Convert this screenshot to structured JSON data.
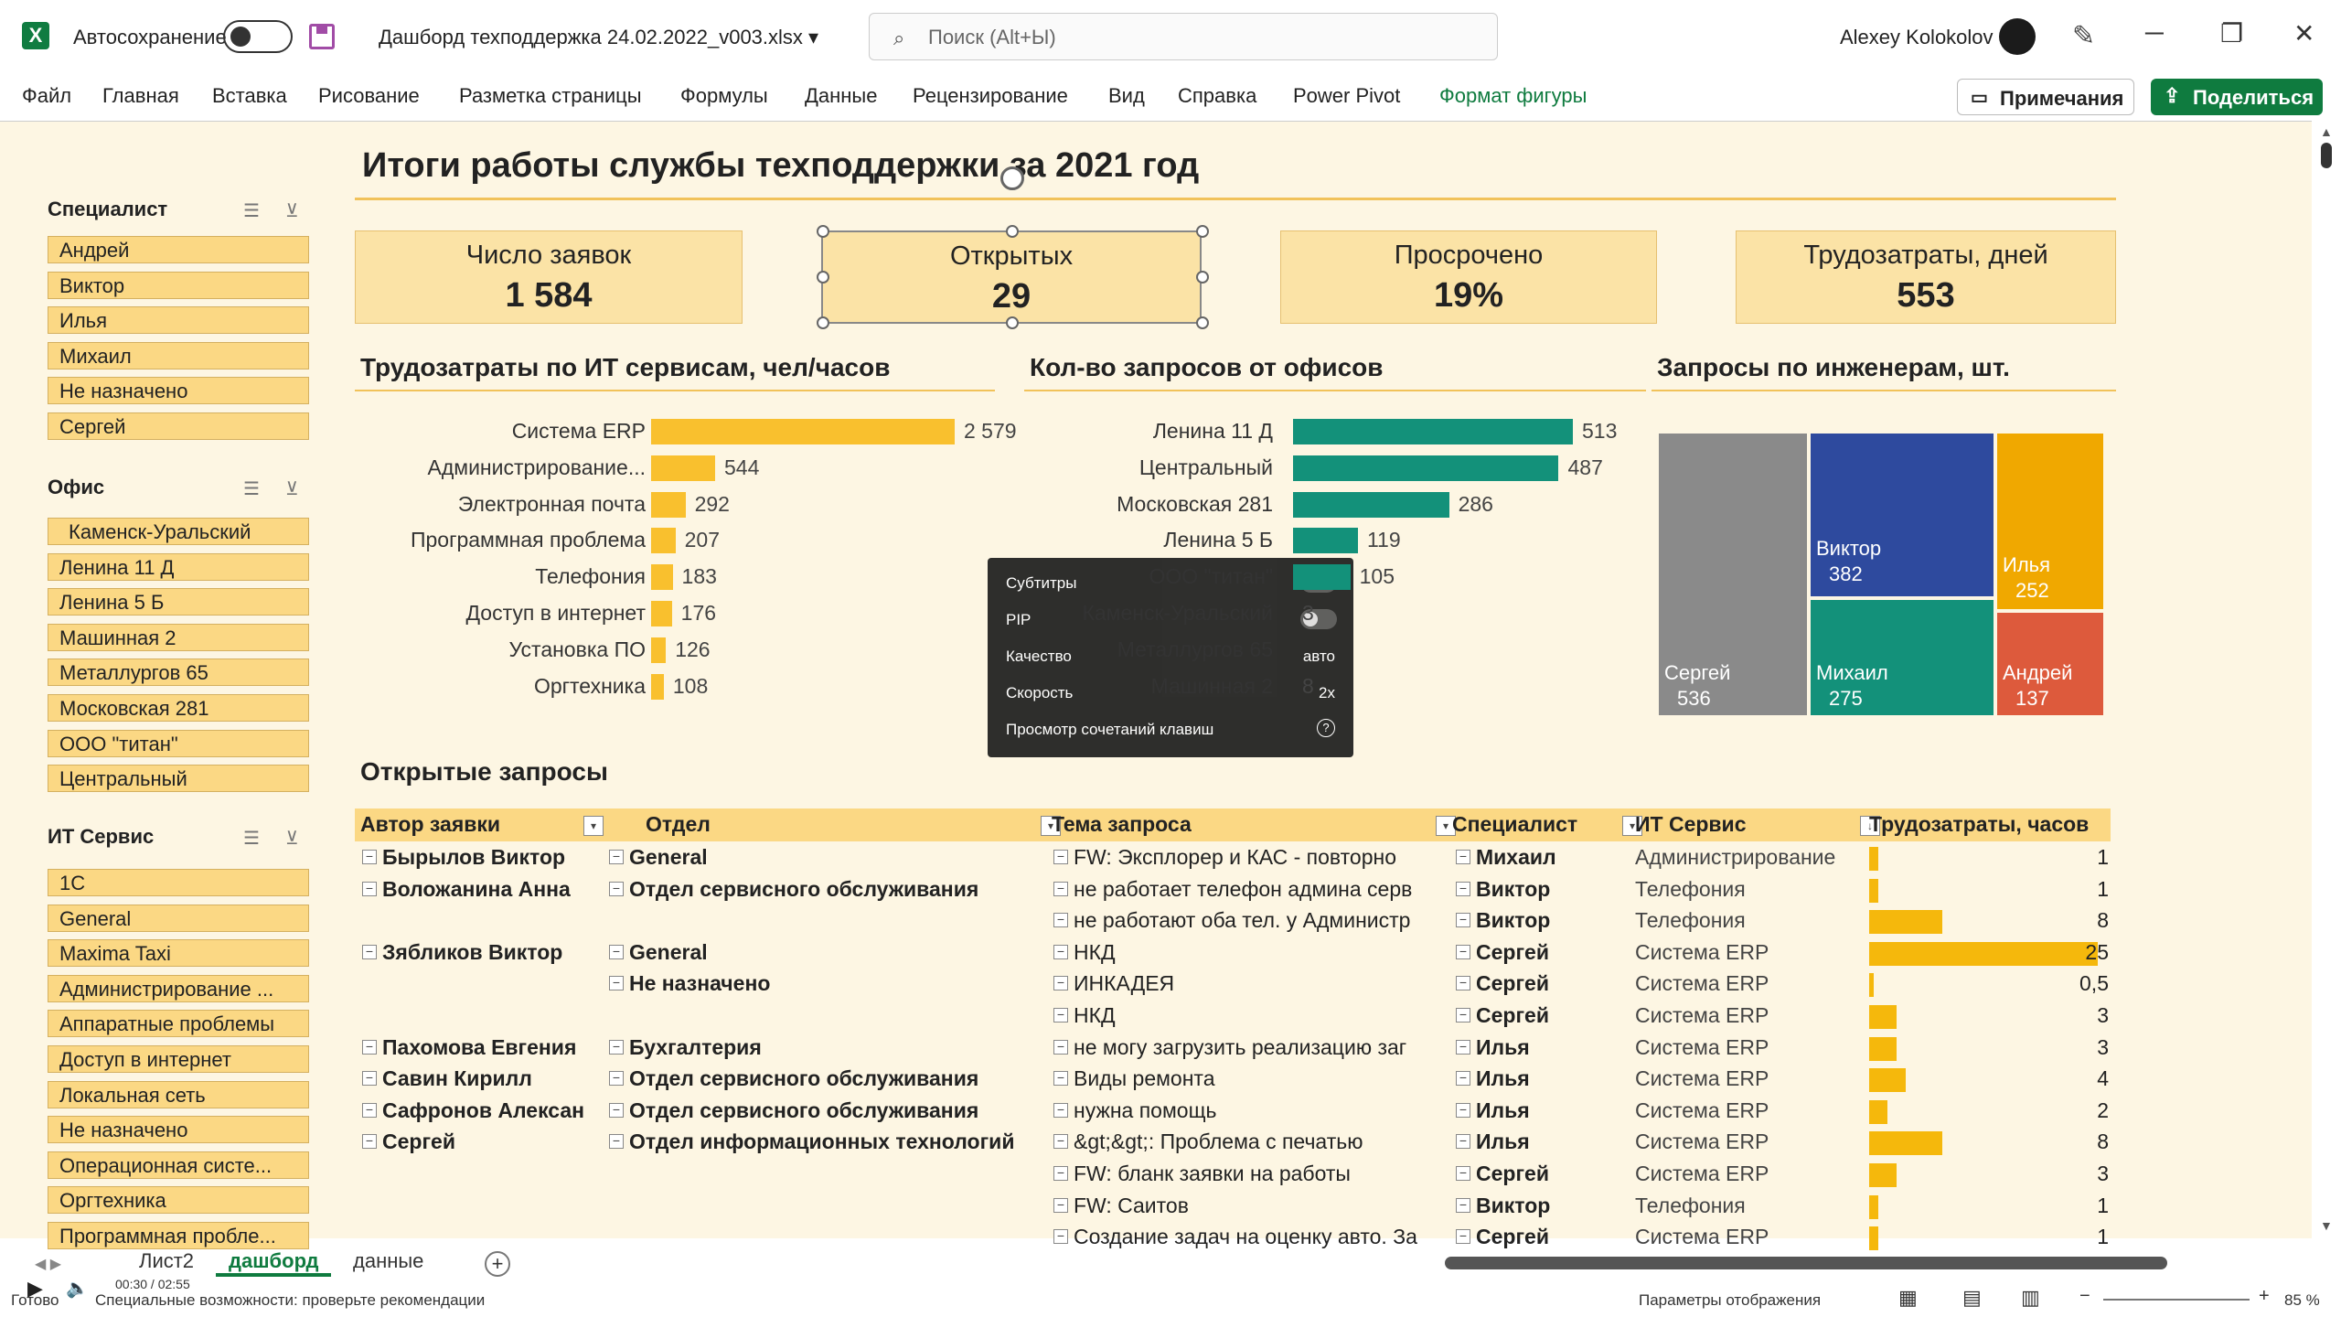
{
  "app": {
    "logo": "X",
    "autosave_label": "Автосохранение",
    "filename": "Дашборд техподдержка 24.02.2022_v003.xlsx ▾",
    "search_placeholder": "Поиск (Alt+Ы)",
    "user": "Alexey Kolokolov"
  },
  "menu": [
    "Файл",
    "Главная",
    "Вставка",
    "Рисование",
    "Разметка страницы",
    "Формулы",
    "Данные",
    "Рецензирование",
    "Вид",
    "Справка",
    "Power Pivot",
    "Формат фигуры"
  ],
  "menu_accent": "#0f7b3f",
  "buttons": {
    "notes": "Примечания",
    "share": "Поделиться"
  },
  "slicers": {
    "specialist": {
      "title": "Специалист",
      "items": [
        "Андрей",
        "Виктор",
        "Илья",
        "Михаил",
        "Не назначено",
        "Сергей"
      ]
    },
    "office": {
      "title": "Офис",
      "items": [
        "Каменск-Уральский",
        "Ленина 11 Д",
        "Ленина 5 Б",
        "Машинная 2",
        "Металлургов 65",
        "Московская 281",
        "ООО \"титан\"",
        "Центральный"
      ]
    },
    "service": {
      "title": "ИТ Сервис",
      "items": [
        "1С",
        "General",
        "Maxima Taxi",
        "Администрирование ...",
        "Аппаратные проблемы",
        "Доступ в интернет",
        "Локальная сеть",
        "Не назначено",
        "Операционная систе...",
        "Оргтехника",
        "Программная пробле..."
      ]
    }
  },
  "dashboard": {
    "title": "Итоги работы службы техподдержки за 2021 год",
    "kpis": [
      {
        "label": "Число заявок",
        "value": "1 584"
      },
      {
        "label": "Открытых",
        "value": "29"
      },
      {
        "label": "Просрочено",
        "value": "19%"
      },
      {
        "label": "Трудозатраты, дней",
        "value": "553"
      }
    ]
  },
  "chart_data": [
    {
      "type": "bar",
      "title": "Трудозатраты по ИТ сервисам, чел/часов",
      "categories": [
        "Система ERP",
        "Администрирование...",
        "Электронная почта",
        "Программная проблема",
        "Телефония",
        "Доступ в интернет",
        "Установка ПО",
        "Оргтехника"
      ],
      "values": [
        2579,
        544,
        292,
        207,
        183,
        176,
        126,
        108
      ],
      "labels": [
        "2 579",
        "544",
        "292",
        "207",
        "183",
        "176",
        "126",
        "108"
      ],
      "color": "#f9c02e"
    },
    {
      "type": "bar",
      "title": "Кол-во запросов от офисов",
      "categories": [
        "Ленина 11 Д",
        "Центральный",
        "Московская 281",
        "Ленина 5 Б",
        "ООО \"титан\"",
        "Каменск-Уральский",
        "Металлургов 65",
        "Машинная 2"
      ],
      "values": [
        513,
        487,
        286,
        119,
        105,
        null,
        null,
        null
      ],
      "labels": [
        "513",
        "487",
        "286",
        "119",
        "105",
        "3",
        "",
        "8"
      ],
      "color": "#13917a"
    },
    {
      "type": "heatmap",
      "title": "Запросы по инженерам, шт.",
      "items": [
        {
          "name": "Сергей",
          "value": 536,
          "color": "#8a8a8a"
        },
        {
          "name": "Виктор",
          "value": 382,
          "color": "#2e4a9e"
        },
        {
          "name": "Михаил",
          "value": 275,
          "color": "#13917a"
        },
        {
          "name": "Илья",
          "value": 252,
          "color": "#f0a800"
        },
        {
          "name": "Андрей",
          "value": 137,
          "color": "#dd5a3c"
        }
      ]
    }
  ],
  "overlay": {
    "subtitles": "Субтитры",
    "pip": "PIP",
    "quality": "Качество",
    "quality_val": "авто",
    "speed": "Скорость",
    "speed_val": "2x",
    "shortcuts": "Просмотр сочетаний клавиш",
    "help": "?"
  },
  "open_requests": {
    "title": "Открытые запросы",
    "headers": [
      "Автор заявки",
      "Отдел",
      "Тема запроса",
      "Специалист",
      "ИТ Сервис",
      "Трудозатраты, часов"
    ],
    "rows": [
      {
        "author": "Бырылов Виктор",
        "dept": "General",
        "topic": "FW: Эксплорер и КАС - повторно",
        "spec": "Михаил",
        "service": "Администрирование",
        "hours": "1",
        "v": 1
      },
      {
        "author": "Воложанина Анна",
        "dept": "Отдел сервисного обслуживания",
        "topic": "не работает телефон админа серв",
        "spec": "Виктор",
        "service": "Телефония",
        "hours": "1",
        "v": 1
      },
      {
        "author": "",
        "dept": "",
        "topic": "не работают оба тел. у Администр",
        "spec": "Виктор",
        "service": "Телефония",
        "hours": "8",
        "v": 8
      },
      {
        "author": "Зябликов Виктор",
        "dept": "General",
        "topic": "НКД",
        "spec": "Сергей",
        "service": "Система ERP",
        "hours": "25",
        "v": 25
      },
      {
        "author": "",
        "dept": "Не назначено",
        "topic": "ИНКАДЕЯ",
        "spec": "Сергей",
        "service": "Система ERP",
        "hours": "0,5",
        "v": 0.5
      },
      {
        "author": "",
        "dept": "",
        "topic": "НКД",
        "spec": "Сергей",
        "service": "Система ERP",
        "hours": "3",
        "v": 3
      },
      {
        "author": "Пахомова Евгения",
        "dept": "Бухгалтерия",
        "topic": "не могу загрузить реализацию заг",
        "spec": "Илья",
        "service": "Система ERP",
        "hours": "3",
        "v": 3
      },
      {
        "author": "Савин Кирилл",
        "dept": "Отдел сервисного обслуживания",
        "topic": "Виды ремонта",
        "spec": "Илья",
        "service": "Система ERP",
        "hours": "4",
        "v": 4
      },
      {
        "author": "Сафронов Алексан,",
        "dept": "Отдел сервисного обслуживания",
        "topic": "нужна помощь",
        "spec": "Илья",
        "service": "Система ERP",
        "hours": "2",
        "v": 2
      },
      {
        "author": "Сергей",
        "dept": "Отдел информационных технологий",
        "topic": "&gt;&gt;: Проблема с печатью",
        "spec": "Илья",
        "service": "Система ERP",
        "hours": "8",
        "v": 8
      },
      {
        "author": "",
        "dept": "",
        "topic": "FW: бланк заявки на работы",
        "spec": "Сергей",
        "service": "Система ERP",
        "hours": "3",
        "v": 3
      },
      {
        "author": "",
        "dept": "",
        "topic": "FW: Саитов",
        "spec": "Виктор",
        "service": "Телефония",
        "hours": "1",
        "v": 1
      },
      {
        "author": "",
        "dept": "",
        "topic": "Создание задач на оценку авто. За",
        "spec": "Сергей",
        "service": "Система ERP",
        "hours": "1",
        "v": 1
      }
    ]
  },
  "sheets": [
    "Лист2",
    "дашборд",
    "данные"
  ],
  "active_sheet": "дашборд",
  "status": {
    "ready": "Готово",
    "time": "00:30 / 02:55",
    "accessibility": "Специальные возможности: проверьте рекомендации",
    "display": "Параметры отображения",
    "zoom": "85 %"
  }
}
